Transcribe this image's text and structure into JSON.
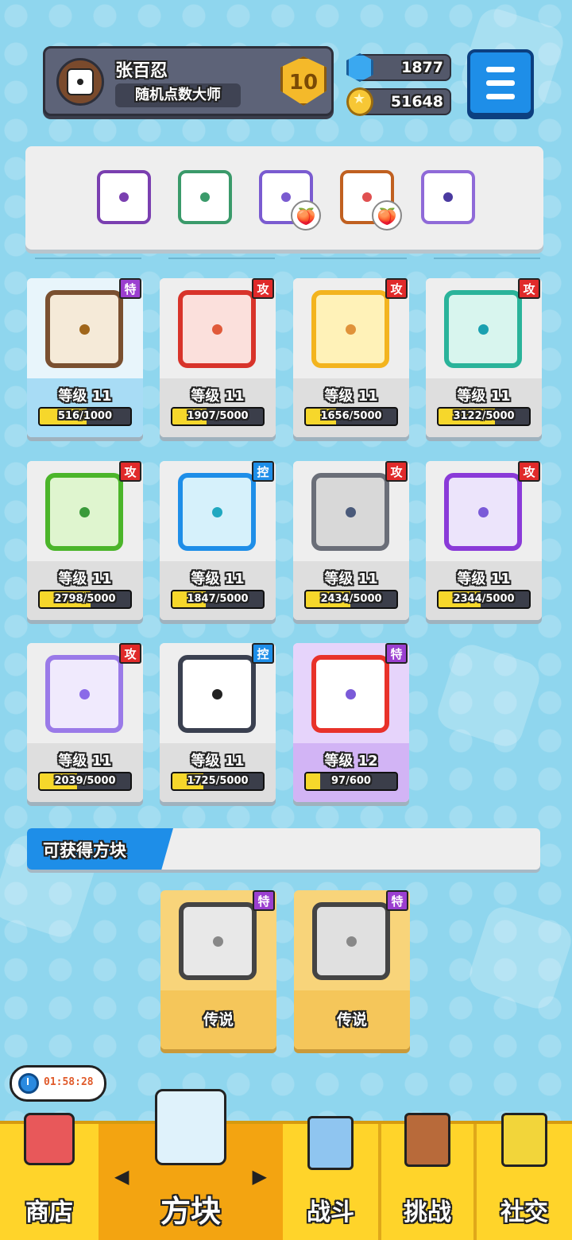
{
  "player": {
    "name": "张百忍",
    "title": "随机点数大师",
    "rank_level": "10"
  },
  "currency": {
    "gems": "1877",
    "coins": "51648"
  },
  "equipped": [
    {
      "name": "saw-block",
      "color": "#7a3fb0",
      "dot": "#7a3fb0"
    },
    {
      "name": "wind-block",
      "color": "#3a9a6a",
      "dot": "#3a9a6a"
    },
    {
      "name": "purple-block",
      "color": "#7a5bd0",
      "dot": "#7a5bd0"
    },
    {
      "name": "rainbow-block",
      "color": "#c06020",
      "dot": "#e05050"
    },
    {
      "name": "crack-block",
      "color": "#8f6ad8",
      "dot": "#4a3aa0"
    }
  ],
  "level_label": "等级",
  "blocks": [
    {
      "tag": "特",
      "tag_color": "#9b3fd0",
      "level": "11",
      "progress": "516/1000",
      "fill": 0.516,
      "border": "#7a5030",
      "dot": "#a0661a",
      "bg": "#f5ead8",
      "top_bg": "#e8f5fb",
      "bottom_bg": "#a8dcf5"
    },
    {
      "tag": "攻",
      "tag_color": "#e02a2a",
      "level": "11",
      "progress": "1907/5000",
      "fill": 0.381,
      "border": "#d8332a",
      "dot": "#e05a3a",
      "bg": "#fbe0dc",
      "top_bg": "#eeeeee",
      "bottom_bg": "#dedede"
    },
    {
      "tag": "攻",
      "tag_color": "#e02a2a",
      "level": "11",
      "progress": "1656/5000",
      "fill": 0.331,
      "border": "#f3b41e",
      "dot": "#e0933a",
      "bg": "#fff2b8",
      "top_bg": "#eeeeee",
      "bottom_bg": "#dedede"
    },
    {
      "tag": "攻",
      "tag_color": "#e02a2a",
      "level": "11",
      "progress": "3122/5000",
      "fill": 0.624,
      "border": "#2ab39a",
      "dot": "#1aa0b0",
      "bg": "#d8f5ee",
      "top_bg": "#eeeeee",
      "bottom_bg": "#dedede"
    },
    {
      "tag": "攻",
      "tag_color": "#e02a2a",
      "level": "11",
      "progress": "2798/5000",
      "fill": 0.56,
      "border": "#4bb52a",
      "dot": "#3a9a3a",
      "bg": "#dff5cf",
      "top_bg": "#eeeeee",
      "bottom_bg": "#dedede"
    },
    {
      "tag": "控",
      "tag_color": "#1e8ee8",
      "level": "11",
      "progress": "1847/5000",
      "fill": 0.369,
      "border": "#1e8ee8",
      "dot": "#20a8c0",
      "bg": "#d6f1fb",
      "top_bg": "#eeeeee",
      "bottom_bg": "#dedede"
    },
    {
      "tag": "攻",
      "tag_color": "#e02a2a",
      "level": "11",
      "progress": "2434/5000",
      "fill": 0.487,
      "border": "#6a6e78",
      "dot": "#4a5a7a",
      "bg": "#d8d8d8",
      "top_bg": "#eeeeee",
      "bottom_bg": "#dedede"
    },
    {
      "tag": "攻",
      "tag_color": "#e02a2a",
      "level": "11",
      "progress": "2344/5000",
      "fill": 0.469,
      "border": "#8a3ad8",
      "dot": "#7a5ad8",
      "bg": "#ece4fb",
      "top_bg": "#eeeeee",
      "bottom_bg": "#dedede"
    },
    {
      "tag": "攻",
      "tag_color": "#e02a2a",
      "level": "11",
      "progress": "2039/5000",
      "fill": 0.408,
      "border": "#9a7ae8",
      "dot": "#8a6ae8",
      "bg": "#f0eafd",
      "top_bg": "#eeeeee",
      "bottom_bg": "#dedede"
    },
    {
      "tag": "控",
      "tag_color": "#1e8ee8",
      "level": "11",
      "progress": "1725/5000",
      "fill": 0.345,
      "border": "#3a4050",
      "dot": "#222222",
      "bg": "#ffffff",
      "top_bg": "#eeeeee",
      "bottom_bg": "#dedede"
    },
    {
      "tag": "特",
      "tag_color": "#9b3fd0",
      "level": "12",
      "progress": "97/600",
      "fill": 0.162,
      "border": "#e8322a",
      "dot": "#7a5ad8",
      "bg": "#ffffff",
      "top_bg": "#e6d4fb",
      "bottom_bg": "#d2b4f5"
    }
  ],
  "obtainable": {
    "title": "可获得方块",
    "items": [
      {
        "tag": "特",
        "label": "传说"
      },
      {
        "tag": "特",
        "label": "传说"
      }
    ]
  },
  "timer": "01:58:28",
  "nav": {
    "shop": "商店",
    "blocks": "方块",
    "battle": "战斗",
    "challenge": "挑战",
    "social": "社交"
  },
  "colors": {
    "background": "#8fd6ee",
    "accent_blue": "#1e8ee8",
    "nav_yellow": "#ffd42a",
    "progress_yellow": "#f6d72b"
  }
}
